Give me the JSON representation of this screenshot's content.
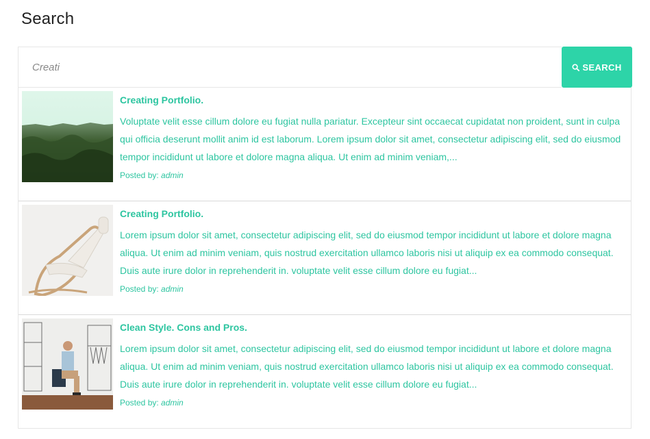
{
  "page": {
    "title": "Search"
  },
  "search": {
    "value": "Creati",
    "button_label": "SEARCH",
    "button_icon": "search-icon",
    "accent_color": "#2dd4a8"
  },
  "results": [
    {
      "title": "Creating Portfolio.",
      "excerpt": "Voluptate velit esse cillum dolore eu fugiat nulla pariatur. Excepteur sint occaecat cupidatat non proident, sunt in culpa qui officia deserunt mollit anim id est laborum. Lorem ipsum dolor sit amet, consectetur adipiscing elit, sed do eiusmod tempor incididunt ut labore et dolore magna aliqua. Ut enim ad minim veniam,...",
      "posted_by_label": "Posted by:",
      "author": "admin",
      "image": "forest-landscape"
    },
    {
      "title": "Creating Portfolio.",
      "excerpt": "Lorem ipsum dolor sit amet, consectetur adipiscing elit, sed do eiusmod tempor incididunt ut labore et dolore magna aliqua. Ut enim ad minim veniam, quis nostrud exercitation ullamco laboris nisi ut aliquip ex ea commodo consequat. Duis aute irure dolor in reprehenderit in. voluptate velit esse cillum dolore eu fugiat...",
      "posted_by_label": "Posted by:",
      "author": "admin",
      "image": "lounge-chair"
    },
    {
      "title": "Clean Style. Cons and Pros.",
      "excerpt": "Lorem ipsum dolor sit amet, consectetur adipiscing elit, sed do eiusmod tempor incididunt ut labore et dolore magna aliqua. Ut enim ad minim veniam, quis nostrud exercitation ullamco laboris nisi ut aliquip ex ea commodo consequat. Duis aute irure dolor in reprehenderit in. voluptate velit esse cillum dolore eu fugiat...",
      "posted_by_label": "Posted by:",
      "author": "admin",
      "image": "man-sitting-sketch-wardrobe"
    }
  ]
}
